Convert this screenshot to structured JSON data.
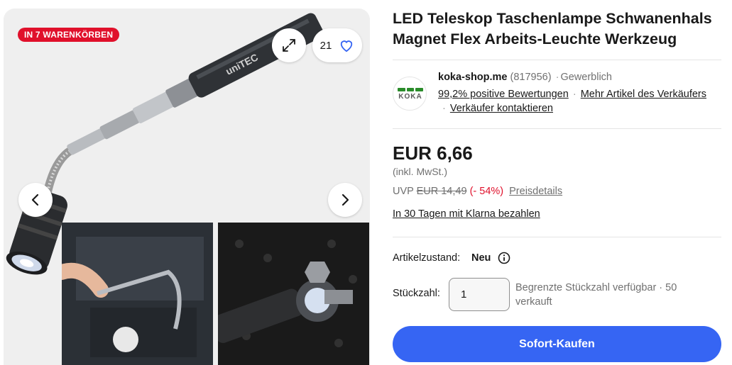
{
  "gallery": {
    "badge": "IN 7 WARENKÖRBEN",
    "watch_count": "21"
  },
  "title": "LED Teleskop Taschenlampe Schwanenhals Magnet Flex Arbeits-Leuchte Werkzeug",
  "seller": {
    "logo_text": "KOKA",
    "name": "koka-shop.me",
    "feedback_count": "(817956)",
    "type": "Gewerblich",
    "positive": "99,2% positive Bewertungen",
    "more_items": "Mehr Artikel des Verkäufers",
    "contact": "Verkäufer kontaktieren"
  },
  "price": {
    "main": "EUR 6,66",
    "tax": "(inkl. MwSt.)",
    "uvp_label": "UVP",
    "uvp_value": "EUR 14,49",
    "discount": "(- 54%)",
    "details": "Preisdetails",
    "klarna": "In 30 Tagen mit Klarna bezahlen"
  },
  "condition": {
    "label": "Artikelzustand:",
    "value": "Neu"
  },
  "quantity": {
    "label": "Stückzahl:",
    "value": "1",
    "note": "Begrenzte Stückzahl verfügbar · 50 verkauft"
  },
  "buy_button": "Sofort-Kaufen",
  "colors": {
    "accent": "#3665f3",
    "badge": "#e0102b"
  }
}
